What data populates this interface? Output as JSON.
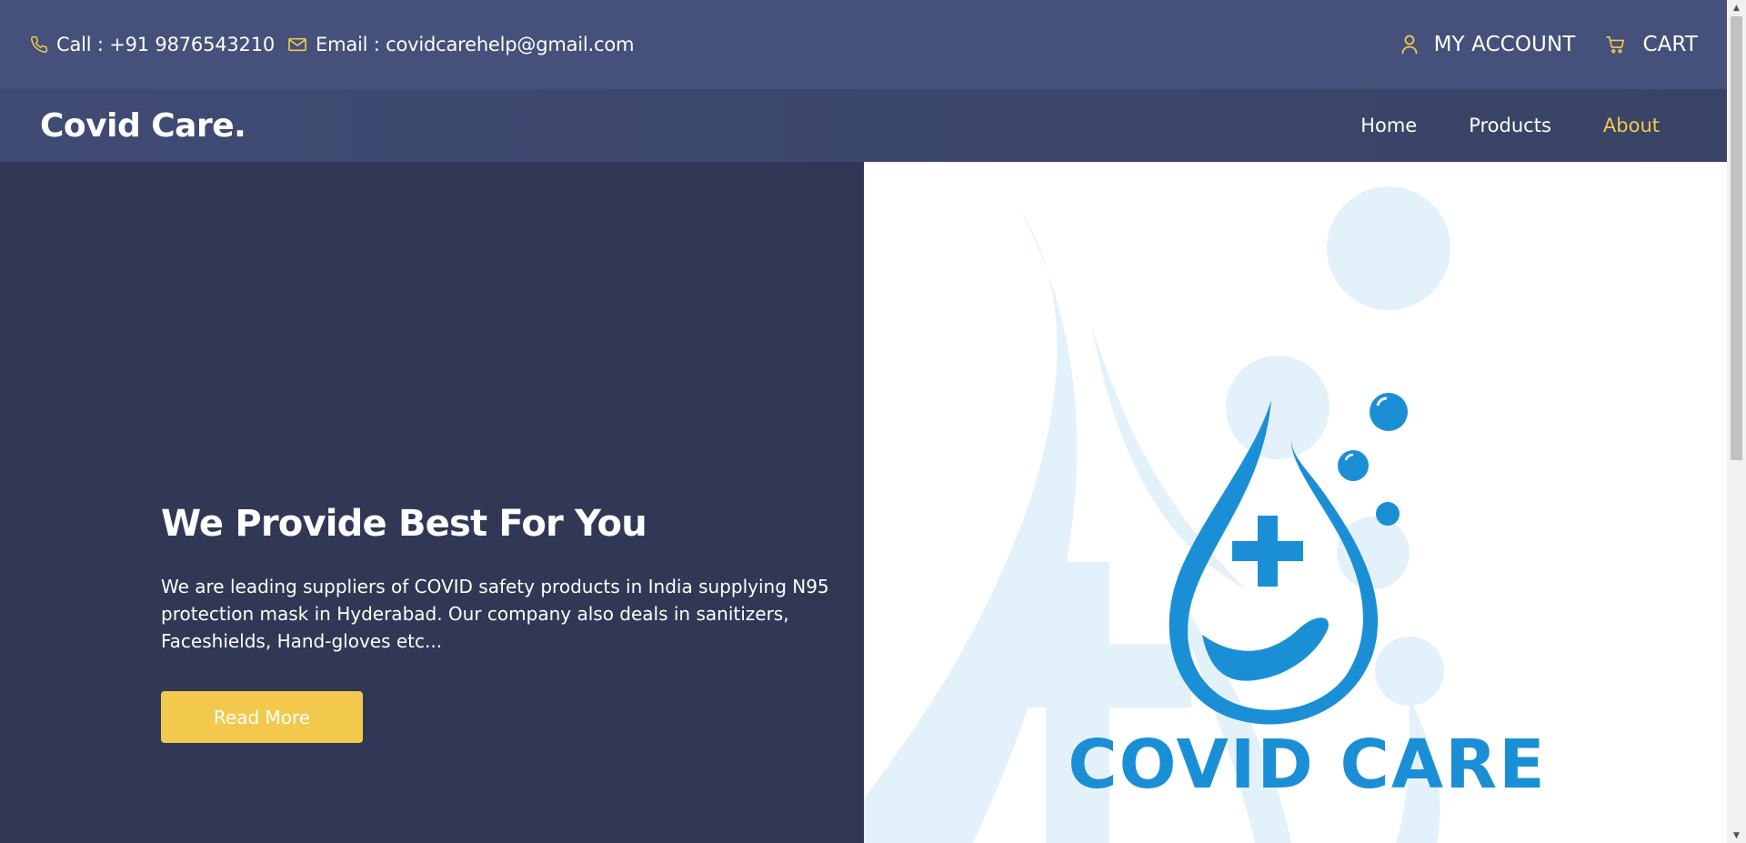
{
  "topbar": {
    "call_label": "Call : +91 9876543210",
    "email_label": "Email : covidcarehelp@gmail.com",
    "account_label": "MY ACCOUNT",
    "cart_label": "CART",
    "icons": [
      "phone-icon",
      "mail-icon",
      "user-icon",
      "cart-icon"
    ],
    "icon_color": "#f2c94c"
  },
  "nav": {
    "brand": "Covid Care.",
    "links": [
      {
        "label": "Home",
        "active": false
      },
      {
        "label": "Products",
        "active": false
      },
      {
        "label": "About",
        "active": true
      }
    ]
  },
  "hero": {
    "title": "We Provide Best For You",
    "description": "We are leading suppliers of COVID safety products in India supplying N95 protection mask in Hyderabad. Our company also deals in sanitizers, Faceshields, Hand-gloves etc...",
    "button_label": "Read More"
  },
  "logo": {
    "text": "COVID CARE",
    "color": "#1a8fd6",
    "bg_shape_color": "#e3f1fa"
  },
  "colors": {
    "topbar_bg": "#45507b",
    "nav_bg": "#3d4770",
    "hero_bg": "#303856",
    "accent": "#f2c94c"
  }
}
